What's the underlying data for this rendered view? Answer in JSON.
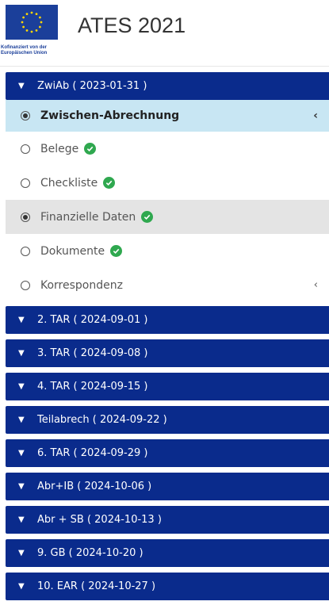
{
  "header": {
    "title": "ATES 2021",
    "eu_caption_line1": "Kofinanziert von der",
    "eu_caption_line2": "Europäischen Union"
  },
  "groups": [
    {
      "label": "ZwiAb ( 2023-01-31 )"
    },
    {
      "label": "2. TAR ( 2024-09-01 )"
    },
    {
      "label": "3. TAR ( 2024-09-08 )"
    },
    {
      "label": "4. TAR ( 2024-09-15 )"
    },
    {
      "label": "Teilabrech ( 2024-09-22 )"
    },
    {
      "label": "6. TAR ( 2024-09-29 )"
    },
    {
      "label": "Abr+IB ( 2024-10-06 )"
    },
    {
      "label": "Abr + SB ( 2024-10-13 )"
    },
    {
      "label": "9. GB ( 2024-10-20 )"
    },
    {
      "label": "10. EAR ( 2024-10-27 )"
    }
  ],
  "subsection": {
    "title": "Zwischen-Abrechnung",
    "items": [
      {
        "label": "Belege",
        "checked": true
      },
      {
        "label": "Checkliste",
        "checked": true
      },
      {
        "label": "Finanzielle Daten",
        "checked": true,
        "active": true
      },
      {
        "label": "Dokumente",
        "checked": true
      },
      {
        "label": "Korrespondenz",
        "checked": false
      }
    ]
  },
  "colors": {
    "group_bg": "#0a2b8c",
    "subhead_bg": "#c8e6f3",
    "active_bg": "#e4e4e4",
    "check": "#2fa84f",
    "eu_blue": "#1b3f9a",
    "eu_star": "#ffd700"
  }
}
